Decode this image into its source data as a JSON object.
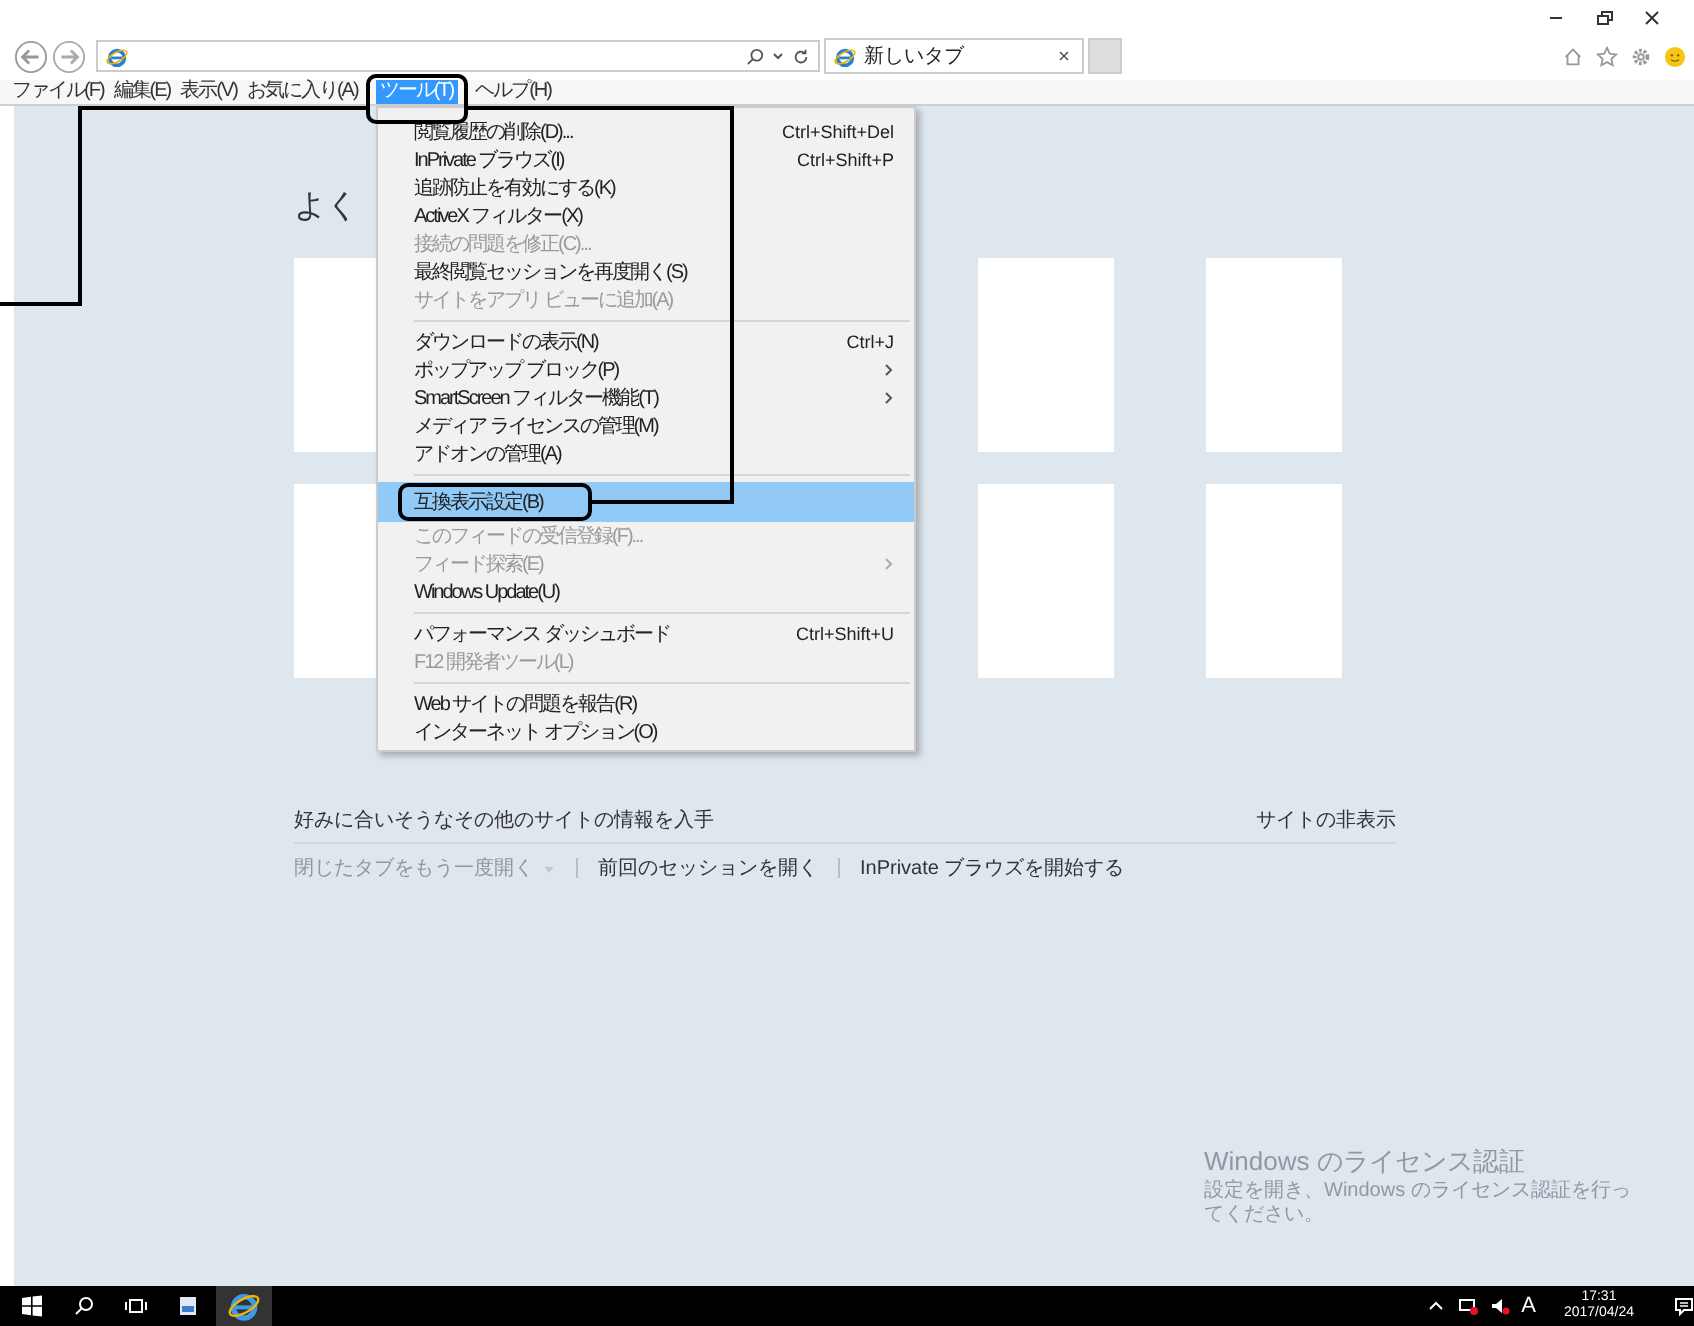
{
  "tabs": [
    {
      "label": "新しいタブ",
      "selected": true
    }
  ],
  "menu_bar": [
    {
      "label": "ファイル(F)",
      "selected": false
    },
    {
      "label": "編集(E)",
      "selected": false
    },
    {
      "label": "表示(V)",
      "selected": false
    },
    {
      "label": "お気に入り(A)",
      "selected": false
    },
    {
      "label": "ツール(T)",
      "selected": true
    },
    {
      "label": "ヘルプ(H)",
      "selected": false
    }
  ],
  "tools_menu": {
    "sections": [
      [
        {
          "label": "閲覧履歴の削除(D)...",
          "shortcut": "Ctrl+Shift+Del",
          "disabled": false,
          "submenu": false,
          "selected": false
        },
        {
          "label": "InPrivate ブラウズ(I)",
          "shortcut": "Ctrl+Shift+P",
          "disabled": false,
          "submenu": false,
          "selected": false
        },
        {
          "label": "追跡防止を有効にする(K)",
          "disabled": false,
          "submenu": false,
          "selected": false
        },
        {
          "label": "ActiveX フィルター(X)",
          "disabled": false,
          "submenu": false,
          "selected": false
        },
        {
          "label": "接続の問題を修正(C)...",
          "disabled": true,
          "submenu": false,
          "selected": false
        },
        {
          "label": "最終閲覧セッションを再度開く(S)",
          "disabled": false,
          "submenu": false,
          "selected": false
        },
        {
          "label": "サイトをアプリ ビューに追加(A)",
          "disabled": true,
          "submenu": false,
          "selected": false
        }
      ],
      [
        {
          "label": "ダウンロードの表示(N)",
          "shortcut": "Ctrl+J",
          "disabled": false,
          "submenu": false,
          "selected": false
        },
        {
          "label": "ポップアップ ブロック(P)",
          "disabled": false,
          "submenu": true,
          "selected": false
        },
        {
          "label": "SmartScreen フィルター機能(T)",
          "disabled": false,
          "submenu": true,
          "selected": false
        },
        {
          "label": "メディア ライセンスの管理(M)",
          "disabled": false,
          "submenu": false,
          "selected": false
        },
        {
          "label": "アドオンの管理(A)",
          "disabled": false,
          "submenu": false,
          "selected": false
        }
      ],
      [
        {
          "label": "互換表示設定(B)",
          "disabled": false,
          "submenu": false,
          "selected": true
        },
        {
          "label": "このフィードの受信登録(F)...",
          "disabled": true,
          "submenu": false,
          "selected": false
        },
        {
          "label": "フィード探索(E)",
          "disabled": true,
          "submenu": true,
          "selected": false
        },
        {
          "label": "Windows Update(U)",
          "disabled": false,
          "submenu": false,
          "selected": false
        }
      ],
      [
        {
          "label": "パフォーマンス ダッシュボード",
          "shortcut": "Ctrl+Shift+U",
          "disabled": false,
          "submenu": false,
          "selected": false
        },
        {
          "label": "F12 開発者ツール(L)",
          "disabled": true,
          "submenu": false,
          "selected": false
        }
      ],
      [
        {
          "label": "Web サイトの問題を報告(R)",
          "disabled": false,
          "submenu": false,
          "selected": false
        },
        {
          "label": "インターネット オプション(O)",
          "disabled": false,
          "submenu": false,
          "selected": false
        }
      ]
    ]
  },
  "page": {
    "heading": "よく",
    "more_sites": "好みに合いそうなその他のサイトの情報を入手",
    "hide_sites": "サイトの非表示",
    "links": [
      {
        "label": "閉じたタブをもう一度開く",
        "disabled": true,
        "dropdown": true
      },
      {
        "label": "前回のセッションを開く",
        "disabled": false,
        "dropdown": false
      },
      {
        "label": "InPrivate ブラウズを開始する",
        "disabled": false,
        "dropdown": false
      }
    ]
  },
  "activation": {
    "title": "Windows のライセンス認証",
    "text": "設定を開き、Windows のライセンス認証を行ってください。"
  },
  "tray": {
    "ime": "A",
    "time": "17:31",
    "date": "2017/04/24"
  }
}
